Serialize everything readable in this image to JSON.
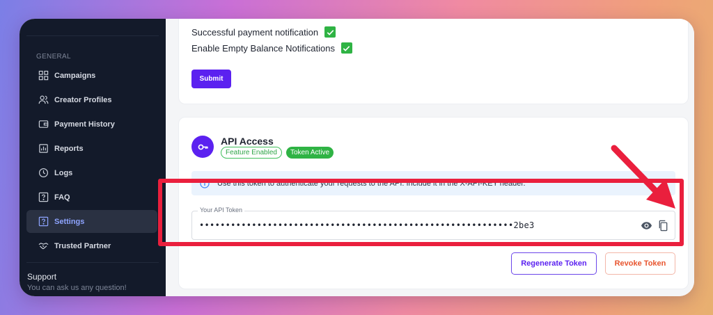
{
  "sidebar": {
    "section_label": "GENERAL",
    "items": [
      {
        "label": "Campaigns",
        "icon": "grid-icon",
        "active": false
      },
      {
        "label": "Creator Profiles",
        "icon": "users-icon",
        "active": false
      },
      {
        "label": "Payment History",
        "icon": "wallet-icon",
        "active": false
      },
      {
        "label": "Reports",
        "icon": "report-icon",
        "active": false
      },
      {
        "label": "Logs",
        "icon": "clock-icon",
        "active": false
      },
      {
        "label": "FAQ",
        "icon": "question-icon",
        "active": false
      },
      {
        "label": "Settings",
        "icon": "question-icon",
        "active": true
      },
      {
        "label": "Trusted Partner",
        "icon": "handshake-icon",
        "active": false
      }
    ],
    "support": {
      "title": "Support",
      "subtitle": "You can ask us any question!"
    }
  },
  "notifications": {
    "successful_payment_label": "Successful payment notification",
    "empty_balance_label": "Enable Empty Balance Notifications",
    "submit_label": "Submit"
  },
  "api_access": {
    "title": "API Access",
    "badge_feature": "Feature Enabled",
    "badge_token": "Token Active",
    "info_text": "Use this token to authenticate your requests to the API. Include it in the X-API-KEY header.",
    "token_label": "Your API Token",
    "token_value": "••••••••••••••••••••••••••••••••••••••••••••••••••••••••••••2be3",
    "regenerate_label": "Regenerate Token",
    "revoke_label": "Revoke Token"
  },
  "colors": {
    "accent": "#5b21f0",
    "success": "#2fb344",
    "danger": "#ea1f3d",
    "revoke": "#e8552f",
    "sidebar_bg": "#131a2a"
  }
}
